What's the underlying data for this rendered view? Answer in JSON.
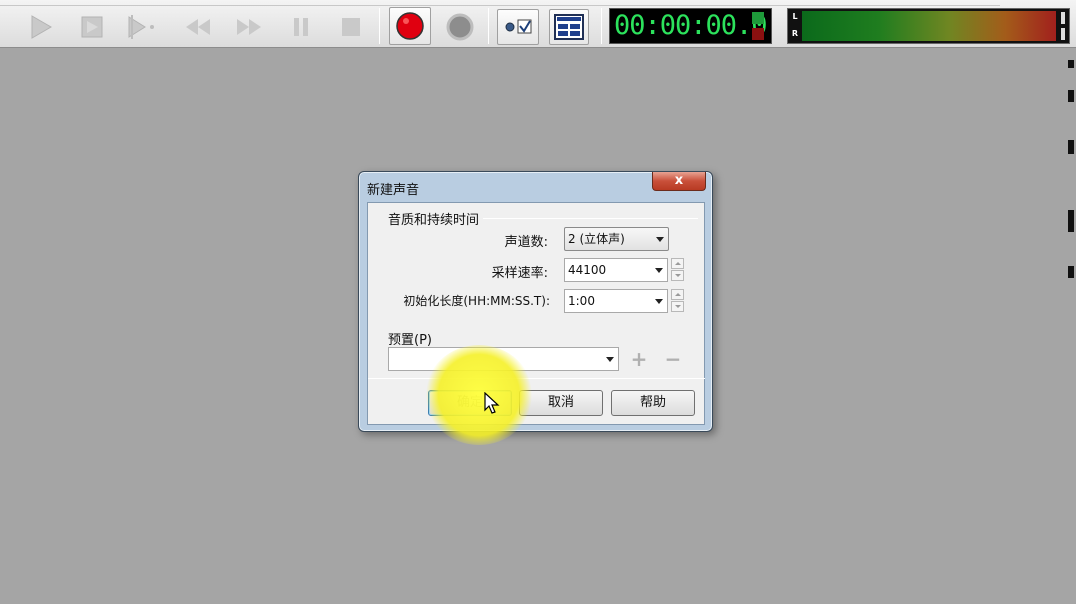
{
  "toolbar": {
    "buttons": [
      "play-icon",
      "stop-to-end-icon",
      "play-from-cursor-icon",
      "rewind-icon",
      "fast-forward-icon",
      "pause-icon",
      "stop-icon",
      "record-icon",
      "loop-record-icon",
      "input-monitor-icon",
      "display-settings-icon"
    ],
    "time": "00:00:00.0",
    "meter": {
      "left_label": "L",
      "right_label": "R"
    }
  },
  "dialog": {
    "title": "新建声音",
    "close_label": "x",
    "group_title": "音质和持续时间",
    "channels": {
      "label": "声道数:",
      "value": "2 (立体声)"
    },
    "sample_rate": {
      "label": "采样速率:",
      "value": "44100"
    },
    "init_length": {
      "label": "初始化长度(HH:MM:SS.T):",
      "value": "1:00"
    },
    "preset": {
      "label": "预置(P)",
      "value": ""
    },
    "buttons": {
      "ok": "确定",
      "cancel": "取消",
      "help": "帮助"
    }
  }
}
